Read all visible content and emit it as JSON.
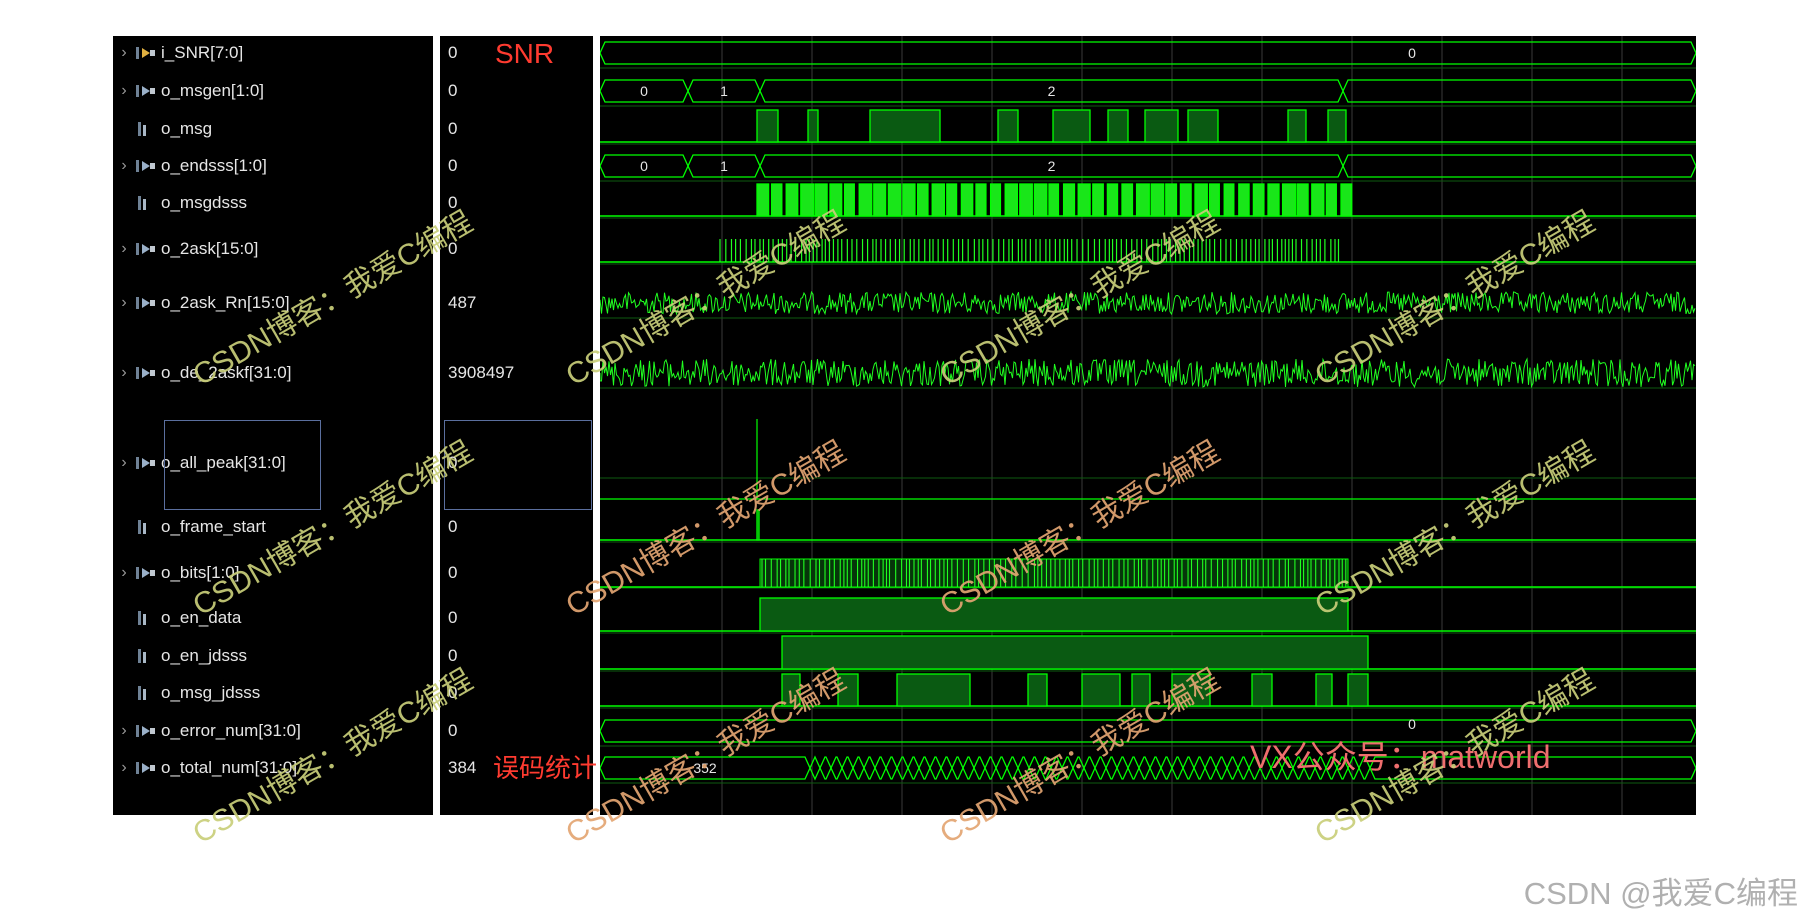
{
  "signals": [
    {
      "name": "i_SNR[7:0]",
      "value": "0",
      "bus": true,
      "icon": "input-bus-icon"
    },
    {
      "name": "o_msgen[1:0]",
      "value": "0",
      "bus": true,
      "icon": "output-bus-icon"
    },
    {
      "name": "o_msg",
      "value": "0",
      "bus": false,
      "icon": "output-bit-icon"
    },
    {
      "name": "o_endsss[1:0]",
      "value": "0",
      "bus": true,
      "icon": "output-bus-icon"
    },
    {
      "name": "o_msgdsss",
      "value": "0",
      "bus": false,
      "icon": "output-bit-icon"
    },
    {
      "name": "o_2ask[15:0]",
      "value": "0",
      "bus": true,
      "icon": "output-bus-icon"
    },
    {
      "name": "o_2ask_Rn[15:0]",
      "value": "487",
      "bus": true,
      "icon": "output-bus-icon"
    },
    {
      "name": "o_de_2askf[31:0]",
      "value": "3908497",
      "bus": true,
      "icon": "output-bus-icon"
    },
    {
      "name": "o_all_peak[31:0]",
      "value": "0",
      "bus": true,
      "icon": "output-bus-icon"
    },
    {
      "name": "o_frame_start",
      "value": "0",
      "bus": false,
      "icon": "output-bit-icon"
    },
    {
      "name": "o_bits[1:0]",
      "value": "0",
      "bus": true,
      "icon": "output-bus-icon"
    },
    {
      "name": "o_en_data",
      "value": "0",
      "bus": false,
      "icon": "output-bit-icon"
    },
    {
      "name": "o_en_jdsss",
      "value": "0",
      "bus": false,
      "icon": "output-bit-icon"
    },
    {
      "name": "o_msg_jdsss",
      "value": "0",
      "bus": false,
      "icon": "output-bit-icon"
    },
    {
      "name": "o_error_num[31:0]",
      "value": "0",
      "bus": true,
      "icon": "output-bus-icon"
    },
    {
      "name": "o_total_num[31:0]",
      "value": "384",
      "bus": true,
      "icon": "output-bus-icon"
    }
  ],
  "annotations": {
    "snr_label": "SNR",
    "error_stat_label": "误码统计",
    "vx_label": "VX公众号：matworld"
  },
  "wave_labels": {
    "snr_value": "0",
    "msgen_values": [
      "0",
      "1",
      "2"
    ],
    "endsss_values": [
      "0",
      "1",
      "2"
    ],
    "error_num_value": "0",
    "total_num_start": "352"
  },
  "watermark_text": "CSDN博客：我爱C编程",
  "footer_credit": "CSDN @我爱C编程",
  "colors": {
    "signal": "#00ff00",
    "signal_fill": "#0a5a12",
    "signal_bright": "#20ff20",
    "grid": "#3a3a3a",
    "panel": "#000000"
  }
}
